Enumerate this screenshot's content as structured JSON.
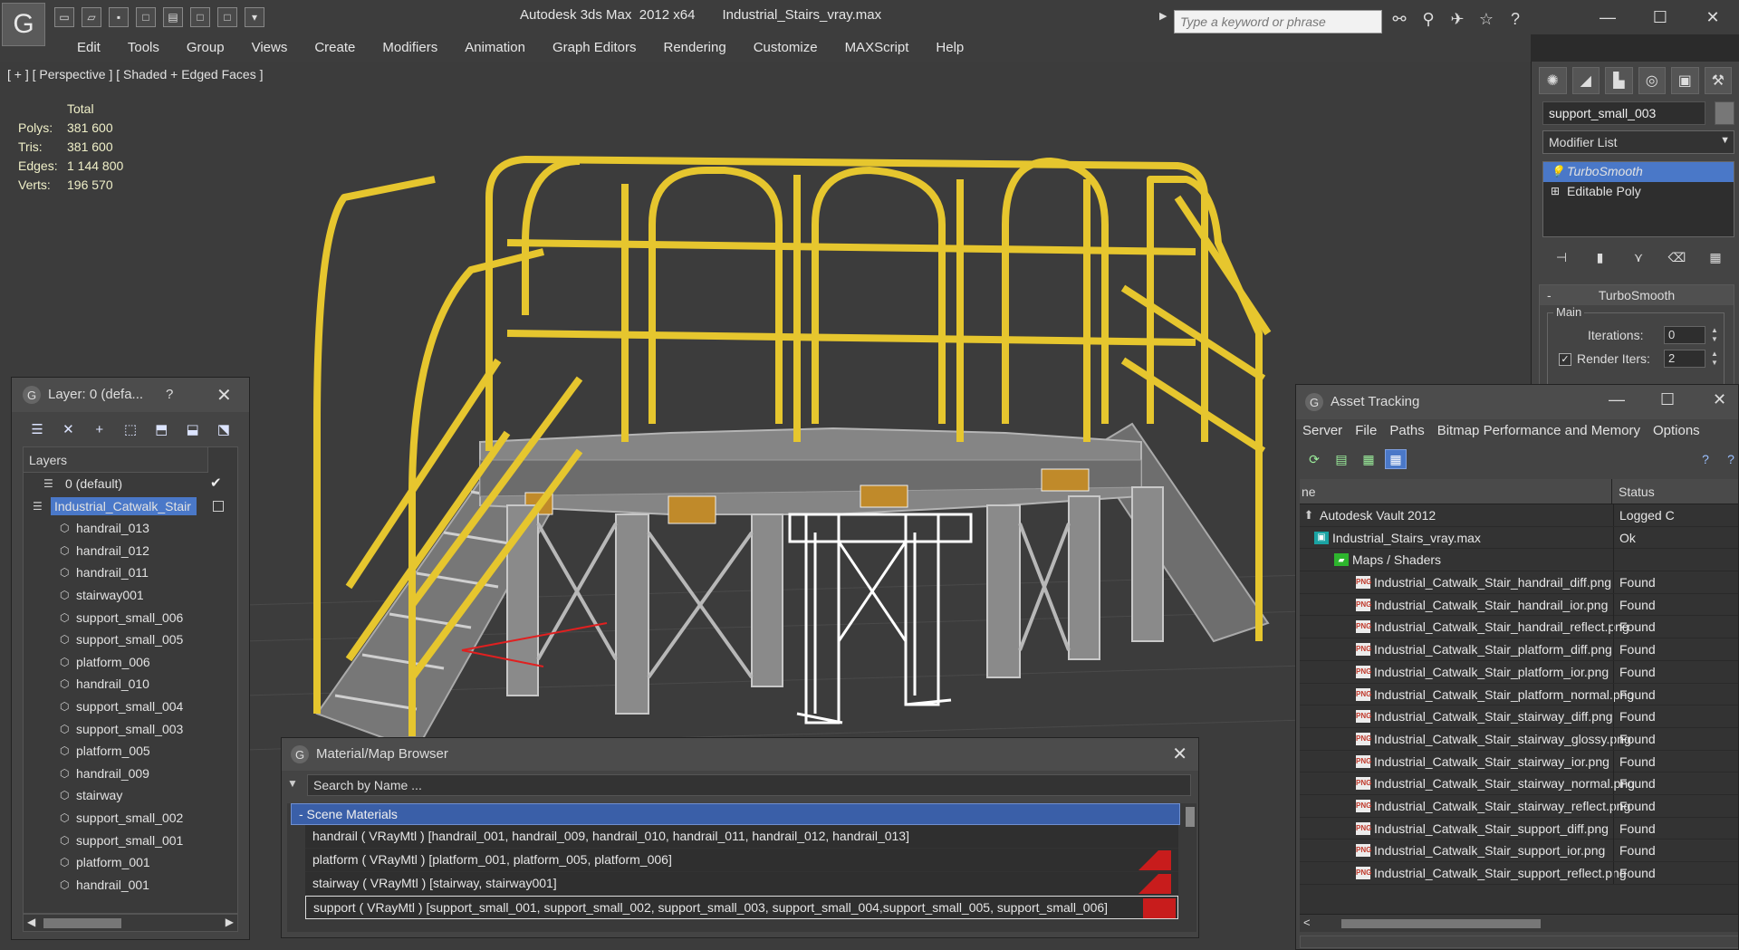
{
  "app": {
    "title": "Autodesk 3ds Max  2012 x64",
    "filename": "Industrial_Stairs_vray.max",
    "logo_glyph": "G"
  },
  "quick_access": [
    "new-icon",
    "open-icon",
    "save-icon",
    "undo-icon",
    "redo-icon",
    "project-icon",
    "folder-icon",
    "dropdown-icon"
  ],
  "search": {
    "placeholder": "Type a keyword or phrase"
  },
  "menu": [
    "Edit",
    "Tools",
    "Group",
    "Views",
    "Create",
    "Modifiers",
    "Animation",
    "Graph Editors",
    "Rendering",
    "Customize",
    "MAXScript",
    "Help"
  ],
  "viewport": {
    "label": "[ + ] [ Perspective ] [ Shaded + Edged Faces ]",
    "stats": {
      "header": "Total",
      "rows": [
        {
          "k": "Polys:",
          "v": "381 600"
        },
        {
          "k": "Tris:",
          "v": "381 600"
        },
        {
          "k": "Edges:",
          "v": "1 144 800"
        },
        {
          "k": "Verts:",
          "v": "196 570"
        }
      ]
    }
  },
  "command_panel": {
    "object_name": "support_small_003",
    "modifier_list": "Modifier List",
    "stack": [
      {
        "label": "TurboSmooth",
        "selected": true
      },
      {
        "label": "Editable Poly",
        "selected": false
      }
    ],
    "turbosmooth": {
      "title": "TurboSmooth",
      "group": "Main",
      "iterations_label": "Iterations:",
      "iterations": "0",
      "render_iters_label": "Render Iters:",
      "render_iters": "2"
    }
  },
  "layer_panel": {
    "title": "Layer: 0 (defa...",
    "help": "?",
    "header": "Layers",
    "rows": [
      {
        "label": "0 (default)",
        "type": "layer"
      },
      {
        "label": "Industrial_Catwalk_Stair",
        "type": "parent"
      },
      {
        "label": "handrail_013",
        "type": "child"
      },
      {
        "label": "handrail_012",
        "type": "child"
      },
      {
        "label": "handrail_011",
        "type": "child"
      },
      {
        "label": "stairway001",
        "type": "child"
      },
      {
        "label": "support_small_006",
        "type": "child"
      },
      {
        "label": "support_small_005",
        "type": "child"
      },
      {
        "label": "platform_006",
        "type": "child"
      },
      {
        "label": "handrail_010",
        "type": "child"
      },
      {
        "label": "support_small_004",
        "type": "child"
      },
      {
        "label": "support_small_003",
        "type": "child"
      },
      {
        "label": "platform_005",
        "type": "child"
      },
      {
        "label": "handrail_009",
        "type": "child"
      },
      {
        "label": "stairway",
        "type": "child"
      },
      {
        "label": "support_small_002",
        "type": "child"
      },
      {
        "label": "support_small_001",
        "type": "child"
      },
      {
        "label": "platform_001",
        "type": "child"
      },
      {
        "label": "handrail_001",
        "type": "child"
      }
    ]
  },
  "material_browser": {
    "title": "Material/Map Browser",
    "search_placeholder": "Search by Name ...",
    "section": "- Scene Materials",
    "rows": [
      "handrail  ( VRayMtl )  [handrail_001, handrail_009, handrail_010, handrail_011, handrail_012, handrail_013]",
      "platform  ( VRayMtl )  [platform_001, platform_005, platform_006]",
      "stairway  ( VRayMtl )  [stairway, stairway001]",
      "support ( VRayMtl ) [support_small_001, support_small_002, support_small_003, support_small_004,support_small_005, support_small_006]"
    ]
  },
  "asset_tracking": {
    "title": "Asset Tracking",
    "menu": [
      "Server",
      "File",
      "Paths",
      "Bitmap Performance and Memory",
      "Options"
    ],
    "col_name": "ne",
    "col_status": "Status",
    "rows": [
      {
        "name": "Autodesk Vault 2012",
        "status": "Logged C",
        "icon": "vault",
        "indent": 0
      },
      {
        "name": "Industrial_Stairs_vray.max",
        "status": "Ok",
        "icon": "max",
        "indent": 1
      },
      {
        "name": "Maps / Shaders",
        "status": "",
        "icon": "maps",
        "indent": 2
      },
      {
        "name": "Industrial_Catwalk_Stair_handrail_diff.png",
        "status": "Found",
        "icon": "png",
        "indent": 3
      },
      {
        "name": "Industrial_Catwalk_Stair_handrail_ior.png",
        "status": "Found",
        "icon": "png",
        "indent": 3
      },
      {
        "name": "Industrial_Catwalk_Stair_handrail_reflect.png",
        "status": "Found",
        "icon": "png",
        "indent": 3
      },
      {
        "name": "Industrial_Catwalk_Stair_platform_diff.png",
        "status": "Found",
        "icon": "png",
        "indent": 3
      },
      {
        "name": "Industrial_Catwalk_Stair_platform_ior.png",
        "status": "Found",
        "icon": "png",
        "indent": 3
      },
      {
        "name": "Industrial_Catwalk_Stair_platform_normal.png",
        "status": "Found",
        "icon": "png",
        "indent": 3
      },
      {
        "name": "Industrial_Catwalk_Stair_stairway_diff.png",
        "status": "Found",
        "icon": "png",
        "indent": 3
      },
      {
        "name": "Industrial_Catwalk_Stair_stairway_glossy.png",
        "status": "Found",
        "icon": "png",
        "indent": 3
      },
      {
        "name": "Industrial_Catwalk_Stair_stairway_ior.png",
        "status": "Found",
        "icon": "png",
        "indent": 3
      },
      {
        "name": "Industrial_Catwalk_Stair_stairway_normal.png",
        "status": "Found",
        "icon": "png",
        "indent": 3
      },
      {
        "name": "Industrial_Catwalk_Stair_stairway_reflect.png",
        "status": "Found",
        "icon": "png",
        "indent": 3
      },
      {
        "name": "Industrial_Catwalk_Stair_support_diff.png",
        "status": "Found",
        "icon": "png",
        "indent": 3
      },
      {
        "name": "Industrial_Catwalk_Stair_support_ior.png",
        "status": "Found",
        "icon": "png",
        "indent": 3
      },
      {
        "name": "Industrial_Catwalk_Stair_support_reflect.png",
        "status": "Found",
        "icon": "png",
        "indent": 3
      }
    ]
  },
  "colors": {
    "selection": "#4a78c8",
    "handrail": "#e6c62e",
    "structure": "#9a9a9a",
    "selected_wire": "#ffffff",
    "material_swatch": "#c81c1c"
  }
}
